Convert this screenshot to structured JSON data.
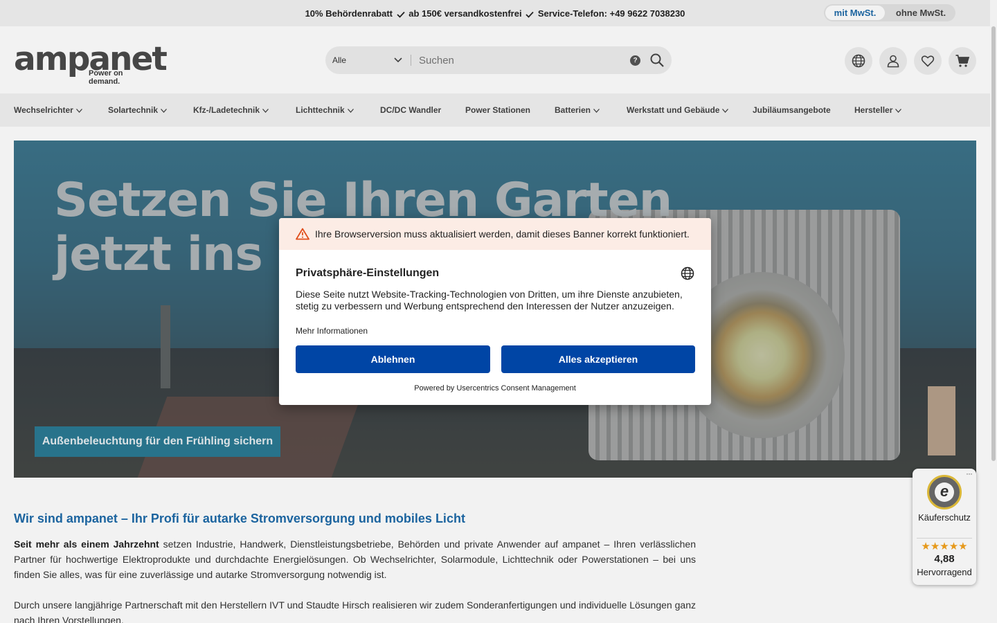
{
  "topbar": {
    "part1": "10% Behördenrabatt",
    "part2": "ab 150€ versandkostenfrei",
    "part3": "Service-Telefon: +49 9622 7038230",
    "vat_with": "mit MwSt.",
    "vat_without": "ohne MwSt."
  },
  "logo": {
    "word": "ampanet",
    "slogan": "Power on demand."
  },
  "search": {
    "category": "Alle",
    "placeholder": "Suchen",
    "help": "?"
  },
  "header_icons": [
    "globe-icon",
    "user-icon",
    "heart-icon",
    "cart-icon"
  ],
  "nav": {
    "items": [
      {
        "label": "Wechselrichter",
        "dropdown": true
      },
      {
        "label": "Solartechnik",
        "dropdown": true
      },
      {
        "label": "Kfz-/Ladetechnik",
        "dropdown": true
      },
      {
        "label": "Lichttechnik",
        "dropdown": true
      },
      {
        "label": "DC/DC Wandler",
        "dropdown": false
      },
      {
        "label": "Power Stationen",
        "dropdown": false
      },
      {
        "label": "Batterien",
        "dropdown": true
      },
      {
        "label": "Werkstatt und Gebäude",
        "dropdown": true
      },
      {
        "label": "Jubiläumsangebote",
        "dropdown": false
      },
      {
        "label": "Hersteller",
        "dropdown": true
      }
    ]
  },
  "hero": {
    "title_line1": "Setzen Sie Ihren Garten",
    "title_line2": "jetzt ins ri",
    "cta": "Außenbeleuchtung für den Frühling sichern"
  },
  "content": {
    "heading": "Wir sind ampanet – Ihr Profi für autarke Stromversorgung und mobiles Licht",
    "p1_bold": "Seit mehr als einem Jahrzehnt",
    "p1_rest": " setzen Industrie, Handwerk, Dienstleistungsbetriebe, Behörden und private Anwender auf ampanet – Ihren verlässlichen Partner für hochwertige Elektroprodukte und durchdachte Energielösungen. Ob Wechselrichter, Solarmodule, Lichttechnik oder Powerstationen – bei uns finden Sie alles, was für eine zuverlässige und autarke Stromversorgung notwendig ist.",
    "p2": "Durch unsere langjährige Partnerschaft mit den Herstellern IVT und Staudte Hirsch realisieren wir zudem Sonderanfertigungen und individuelle Lösungen ganz nach Ihren Vorstellungen."
  },
  "trust_badge": {
    "dots": "···",
    "seal_letter": "e",
    "label": "Käuferschutz",
    "stars": "★★★★★",
    "rating": "4,88",
    "word": "Hervorragend"
  },
  "consent": {
    "warning": "Ihre Browserversion muss aktualisiert werden, damit dieses Banner korrekt funktioniert.",
    "title": "Privatsphäre-Einstellungen",
    "description": "Diese Seite nutzt Website-Tracking-Technologien von Dritten, um ihre Dienste anzubieten, stetig zu verbessern und Werbung entsprechend den Interessen der Nutzer anzuzeigen.",
    "more_info": "Mehr Informationen",
    "deny": "Ablehnen",
    "accept": "Alles akzeptieren",
    "powered": "Powered by Usercentrics Consent Management"
  },
  "colors": {
    "accent_blue": "#1e6aa8",
    "consent_button": "#0045a5",
    "hero_cta": "#2b7a93",
    "star": "#f3a21d"
  }
}
